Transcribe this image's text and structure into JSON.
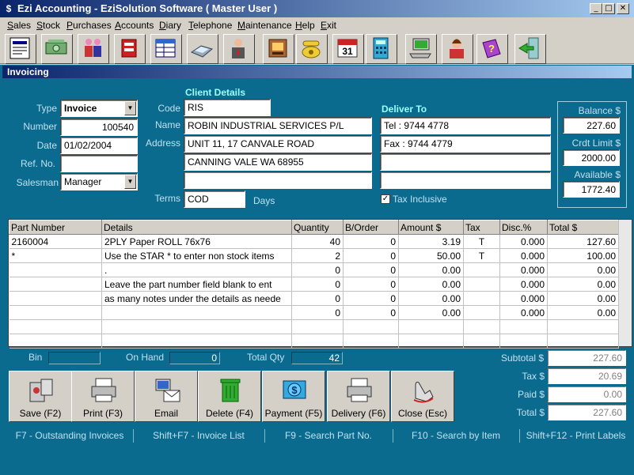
{
  "window": {
    "title": "Ezi Accounting  - EziSolution Software ( Master User )",
    "icon": "dollar-icon",
    "minimize": "_",
    "maximize": "□",
    "close": "✕"
  },
  "menu": [
    "Sales",
    "Stock",
    "Purchases",
    "Accounts",
    "Diary",
    "Telephone",
    "Maintenance",
    "Help",
    "Exit"
  ],
  "panel": {
    "title": "Invoicing"
  },
  "form": {
    "type_label": "Type",
    "type": "Invoice",
    "number_label": "Number",
    "number": "100540",
    "date_label": "Date",
    "date": "01/02/2004",
    "ref_label": "Ref. No.",
    "ref": "",
    "salesman_label": "Salesman",
    "salesman": "Manager"
  },
  "client": {
    "header": "Client Details",
    "code_label": "Code",
    "code": "RIS",
    "name_label": "Name",
    "name": "ROBIN INDUSTRIAL SERVICES P/L",
    "address_label": "Address",
    "address1": "UNIT 11, 17 CANVALE ROAD",
    "address2": "CANNING VALE  WA 68955",
    "address3": "",
    "terms_label": "Terms",
    "terms": "COD",
    "days_label": "Days"
  },
  "deliver": {
    "header": "Deliver To",
    "line1": "Tel : 9744 4778",
    "line2": "Fax : 9744 4779",
    "line3": "",
    "line4": "",
    "tax_inclusive_label": "Tax Inclusive",
    "tax_inclusive": true,
    "check_mark": "✓"
  },
  "balance": {
    "balance_label": "Balance $",
    "balance": "227.60",
    "limit_label": "Crdt Limit $",
    "limit": "2000.00",
    "available_label": "Available $",
    "available": "1772.40"
  },
  "grid": {
    "headers": [
      "Part Number",
      "Details",
      "Quantity",
      "B/Order",
      "Amount $",
      "Tax",
      "Disc.%",
      "Total $"
    ],
    "rows": [
      [
        "2160004",
        "2PLY Paper ROLL 76x76",
        "40",
        "0",
        "3.19",
        "T",
        "0.000",
        "127.60"
      ],
      [
        "*",
        "Use the STAR * to enter non stock items",
        "2",
        "0",
        "50.00",
        "T",
        "0.000",
        "100.00"
      ],
      [
        "",
        ".",
        "0",
        "0",
        "0.00",
        "",
        "0.000",
        "0.00"
      ],
      [
        "",
        "Leave the part number field blank to ent",
        "0",
        "0",
        "0.00",
        "",
        "0.000",
        "0.00"
      ],
      [
        "",
        "as many notes under the details as neede",
        "0",
        "0",
        "0.00",
        "",
        "0.000",
        "0.00"
      ],
      [
        "",
        "",
        "0",
        "0",
        "0.00",
        "",
        "0.000",
        "0.00"
      ],
      [
        "",
        "",
        "",
        "",
        "",
        "",
        "",
        ""
      ],
      [
        "",
        "",
        "",
        "",
        "",
        "",
        "",
        ""
      ]
    ]
  },
  "info": {
    "bin_label": "Bin",
    "bin": "",
    "onhand_label": "On Hand",
    "onhand": "0",
    "totalqty_label": "Total Qty",
    "totalqty": "42"
  },
  "totals": {
    "subtotal_label": "Subtotal $",
    "subtotal": "227.60",
    "tax_label": "Tax $",
    "tax": "20.69",
    "paid_label": "Paid $",
    "paid": "0.00",
    "total_label": "Total $",
    "total": "227.60"
  },
  "buttons": {
    "save": "Save (F2)",
    "print": "Print (F3)",
    "email": "Email",
    "delete": "Delete (F4)",
    "payment": "Payment (F5)",
    "delivery": "Delivery (F6)",
    "close": "Close (Esc)"
  },
  "status": [
    "F7 - Outstanding Invoices",
    "Shift+F7 - Invoice List",
    "F9 - Search Part No.",
    "F10 - Search by Item",
    "Shift+F12 - Print Labels"
  ],
  "colors": {
    "background": "#0b6b8f",
    "label": "#c0e0f0",
    "header": "#99ffff"
  }
}
